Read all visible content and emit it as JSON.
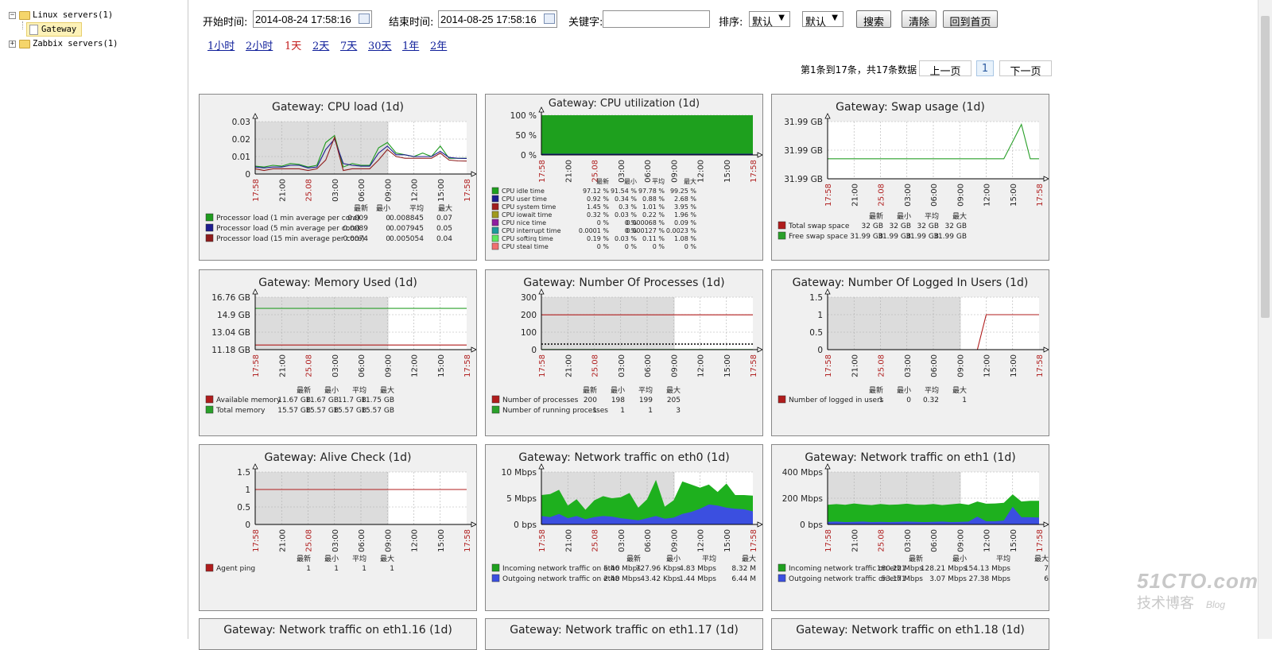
{
  "tree": {
    "linux_servers": "Linux servers(1)",
    "gateway": "Gateway",
    "zabbix_servers": "Zabbix servers(1)"
  },
  "toolbar": {
    "start_label": "开始时间:",
    "start_value": "2014-08-24 17:58:16",
    "end_label": "结束时间:",
    "end_value": "2014-08-25 17:58:16",
    "keyword_label": "关键字:",
    "keyword_value": "",
    "sort_label": "排序:",
    "sort1": "默认",
    "sort2": "默认",
    "search_btn": "搜索",
    "clear_btn": "清除",
    "home_btn": "回到首页"
  },
  "periods": [
    "1小时",
    "2小时",
    "1天",
    "2天",
    "7天",
    "30天",
    "1年",
    "2年"
  ],
  "active_period_index": 2,
  "pagination": {
    "summary": "第1条到17条，共17条数据",
    "prev": "上一页",
    "page": "1",
    "next": "下一页"
  },
  "time_ticks": [
    "17:58",
    "21:00",
    "25.08",
    "03:00",
    "06:00",
    "09:00",
    "12:00",
    "15:00",
    "17:58"
  ],
  "red_ticks": [
    0,
    2,
    8
  ],
  "stat_headers": [
    "最新",
    "最小",
    "平均",
    "最大"
  ],
  "graphs": [
    {
      "title": "Gateway: CPU load (1d)",
      "yticks": [
        "0.03",
        "0.02",
        "0.01",
        "0"
      ],
      "legend": [
        {
          "color": "#1e9b1e",
          "name": "Processor load (1 min average per core)",
          "stats": [
            "0.009",
            "0",
            "0.008845",
            "0.07"
          ]
        },
        {
          "color": "#1d1d8f",
          "name": "Processor load (5 min average per core)",
          "stats": [
            "0.0089",
            "0",
            "0.007945",
            "0.05"
          ]
        },
        {
          "color": "#8f1d1d",
          "name": "Processor load (15 min average per core)",
          "stats": [
            "0.0074",
            "0",
            "0.005054",
            "0.04"
          ]
        }
      ],
      "series": [
        {
          "color": "#1e9b1e",
          "y": [
            0.0045,
            0.004,
            0.005,
            0.0045,
            0.006,
            0.0055,
            0.004,
            0.005,
            0.018,
            0.022,
            0.004,
            0.006,
            0.005,
            0.005,
            0.015,
            0.018,
            0.012,
            0.011,
            0.01,
            0.012,
            0.01,
            0.016,
            0.009,
            0.009,
            0.009
          ]
        },
        {
          "color": "#1d1d8f",
          "y": [
            0.004,
            0.0035,
            0.004,
            0.004,
            0.005,
            0.005,
            0.0035,
            0.004,
            0.014,
            0.02,
            0.006,
            0.005,
            0.0045,
            0.0045,
            0.012,
            0.016,
            0.011,
            0.011,
            0.01,
            0.01,
            0.01,
            0.013,
            0.0095,
            0.009,
            0.0089
          ]
        },
        {
          "color": "#8f1d1d",
          "y": [
            0.003,
            0.002,
            0.003,
            0.003,
            0.003,
            0.003,
            0.002,
            0.003,
            0.008,
            0.021,
            0.002,
            0.003,
            0.003,
            0.003,
            0.008,
            0.014,
            0.01,
            0.009,
            0.009,
            0.009,
            0.009,
            0.012,
            0.008,
            0.0075,
            0.0074
          ]
        }
      ],
      "ymin": 0,
      "ymax": 0.03,
      "shade_frac": 0.63
    },
    {
      "title": "Gateway: CPU utilization (1d)",
      "yticks": [
        "100 %",
        "50 %",
        "0 %"
      ],
      "legend": [
        {
          "color": "#1ea01e",
          "name": "CPU idle time",
          "stats": [
            "97.12 %",
            "91.54 %",
            "97.78 %",
            "99.25 %"
          ]
        },
        {
          "color": "#1d1d8f",
          "name": "CPU user time",
          "stats": [
            "0.92 %",
            "0.34 %",
            "0.88 %",
            "2.68 %"
          ]
        },
        {
          "color": "#a01d1d",
          "name": "CPU system time",
          "stats": [
            "1.45 %",
            "0.3 %",
            "1.01 %",
            "3.95 %"
          ]
        },
        {
          "color": "#a09a1d",
          "name": "CPU iowait time",
          "stats": [
            "0.32 %",
            "0.03 %",
            "0.22 %",
            "1.96 %"
          ]
        },
        {
          "color": "#8f1da0",
          "name": "CPU nice time",
          "stats": [
            "0 %",
            "0 %",
            "0.000068 %",
            "0.09 %"
          ]
        },
        {
          "color": "#1d9a9a",
          "name": "CPU interrupt time",
          "stats": [
            "0.0001 %",
            "0 %",
            "0.000127 %",
            "0.0023 %"
          ]
        },
        {
          "color": "#5ee85e",
          "name": "CPU softirq time",
          "stats": [
            "0.19 %",
            "0.03 %",
            "0.11 %",
            "1.08 %"
          ]
        },
        {
          "color": "#f07070",
          "name": "CPU steal time",
          "stats": [
            "0 %",
            "0 %",
            "0 %",
            "0 %"
          ]
        }
      ],
      "ymin": 0,
      "ymax": 100
    },
    {
      "title": "Gateway: Swap usage (1d)",
      "yticks": [
        "31.99 GB",
        "31.99 GB",
        "31.99 GB"
      ],
      "legend": [
        {
          "color": "#b01c1c",
          "name": "Total swap space",
          "stats": [
            "32 GB",
            "32 GB",
            "32 GB",
            "32 GB"
          ]
        },
        {
          "color": "#2aa02a",
          "name": "Free swap space",
          "stats": [
            "31.99 GB",
            "31.99 GB",
            "31.99 GB",
            "31.99 GB"
          ]
        }
      ],
      "series": [
        {
          "color": "#2aa02a",
          "y": [
            0.35,
            0.35,
            0.35,
            0.35,
            0.35,
            0.35,
            0.35,
            0.35,
            0.35,
            0.35,
            0.35,
            0.35,
            0.35,
            0.35,
            0.35,
            0.35,
            0.35,
            0.35,
            0.35,
            0.35,
            0.35,
            0.65,
            0.95,
            0.35,
            0.35
          ]
        }
      ],
      "ymin": 0,
      "ymax": 1
    },
    {
      "title": "Gateway: Memory Used (1d)",
      "yticks": [
        "16.76 GB",
        "14.9 GB",
        "13.04 GB",
        "11.18 GB"
      ],
      "legend": [
        {
          "color": "#b01c1c",
          "name": "Available memory",
          "stats": [
            "11.67 GB",
            "11.67 GB",
            "11.7 GB",
            "11.75 GB"
          ]
        },
        {
          "color": "#2aa02a",
          "name": "Total memory",
          "stats": [
            "15.57 GB",
            "15.57 GB",
            "15.57 GB",
            "15.57 GB"
          ]
        }
      ],
      "series": [
        {
          "color": "#2aa02a",
          "y": [
            15.57,
            15.57
          ]
        },
        {
          "color": "#b01c1c",
          "y": [
            11.67,
            11.67
          ]
        }
      ],
      "ymin": 11.18,
      "ymax": 16.76,
      "shade_frac": 0.63
    },
    {
      "title": "Gateway: Number Of  Processes (1d)",
      "yticks": [
        "300",
        "200",
        "100",
        "0"
      ],
      "legend": [
        {
          "color": "#b01c1c",
          "name": "Number of processes",
          "stats": [
            "200",
            "198",
            "199",
            "205"
          ]
        },
        {
          "color": "#2aa02a",
          "name": "Number of running processes",
          "stats": [
            "1",
            "1",
            "1",
            "3"
          ]
        }
      ],
      "series": [
        {
          "color": "#b01c1c",
          "y": [
            199,
            199
          ]
        },
        {
          "color": "#2aa02a",
          "y": [
            1,
            1
          ]
        }
      ],
      "ymin": 0,
      "ymax": 300,
      "shade_frac": 0.63
    },
    {
      "title": "Gateway: Number Of Logged In Users (1d)",
      "yticks": [
        "1.5",
        "1",
        "0.5",
        "0"
      ],
      "legend": [
        {
          "color": "#b01c1c",
          "name": "Number of logged in users",
          "stats": [
            "1",
            "0",
            "0.32",
            "1"
          ]
        }
      ],
      "series": [
        {
          "color": "#b01c1c",
          "y": [
            0,
            0,
            0,
            0,
            0,
            0,
            0,
            0,
            0,
            0,
            0,
            0,
            0,
            0,
            0,
            0,
            0,
            0,
            1,
            1,
            1,
            1,
            1,
            1,
            1
          ]
        }
      ],
      "ymin": 0,
      "ymax": 1.5,
      "shade_frac": 0.63
    },
    {
      "title": "Gateway: Alive Check (1d)",
      "yticks": [
        "1.5",
        "1",
        "0.5",
        "0"
      ],
      "legend": [
        {
          "color": "#b01c1c",
          "name": "Agent ping",
          "stats": [
            "1",
            "1",
            "1",
            "1"
          ]
        }
      ],
      "series": [
        {
          "color": "#b01c1c",
          "y": [
            1,
            1
          ]
        }
      ],
      "ymin": 0,
      "ymax": 1.5,
      "shade_frac": 0.63
    },
    {
      "title": "Gateway: Network traffic on eth0 (1d)",
      "yticks": [
        "10 Mbps",
        "5 Mbps",
        "0 bps"
      ],
      "legend": [
        {
          "color": "#1ea01e",
          "name": "Incoming network traffic on eth0",
          "stats": [
            "5.46 Mbps",
            "727.96 Kbps",
            "4.83 Mbps",
            "8.32 M"
          ]
        },
        {
          "color": "#3b4fe0",
          "name": "Outgoing network traffic on eth0",
          "stats": [
            "2.48 Mbps",
            "43.42 Kbps",
            "1.44 Mbps",
            "6.44 M"
          ]
        }
      ],
      "area": [
        {
          "color": "#1eb01e",
          "y": [
            5.6,
            5.8,
            6.6,
            3.6,
            4.8,
            2.8,
            4.6,
            5.4,
            5.0,
            5.2,
            6.0,
            3.2,
            4.8,
            8.5,
            3.4,
            4.6,
            8.2,
            7.6,
            7.0,
            7.6,
            6.2,
            7.8,
            5.6,
            5.6,
            5.5
          ]
        },
        {
          "color": "#3b4fe0",
          "y": [
            1.6,
            1.4,
            2.0,
            1.2,
            1.6,
            1.0,
            1.4,
            1.6,
            1.5,
            1.2,
            1.0,
            0.8,
            1.2,
            1.6,
            1.1,
            1.3,
            2.0,
            2.4,
            3.0,
            3.8,
            3.6,
            3.2,
            3.0,
            2.9,
            2.5
          ]
        }
      ],
      "ymin": 0,
      "ymax": 10,
      "shade_frac": 0.63
    },
    {
      "title": "Gateway: Network traffic on eth1 (1d)",
      "yticks": [
        "400 Mbps",
        "200 Mbps",
        "0 bps"
      ],
      "legend": [
        {
          "color": "#1ea01e",
          "name": "Incoming network traffic on eth1",
          "stats": [
            "180.22 Mbps",
            "128.21 Mbps",
            "154.13 Mbps",
            "7"
          ]
        },
        {
          "color": "#3b4fe0",
          "name": "Outgoing network traffic on eth1",
          "stats": [
            "53.17 Mbps",
            "3.07 Mbps",
            "27.38 Mbps",
            "6"
          ]
        }
      ],
      "area": [
        {
          "color": "#1eb01e",
          "y": [
            150,
            155,
            150,
            160,
            152,
            148,
            156,
            150,
            152,
            158,
            150,
            150,
            156,
            148,
            154,
            160,
            150,
            175,
            158,
            160,
            165,
            230,
            175,
            180,
            180
          ]
        },
        {
          "color": "#3b4fe0",
          "y": [
            20,
            22,
            18,
            20,
            22,
            18,
            20,
            18,
            20,
            22,
            20,
            18,
            20,
            22,
            18,
            20,
            22,
            60,
            24,
            24,
            30,
            135,
            55,
            55,
            53
          ]
        }
      ],
      "ymin": 0,
      "ymax": 400,
      "shade_frac": 0.63
    }
  ],
  "bottom_titles": [
    "Gateway: Network traffic on eth1.16 (1d)",
    "Gateway: Network traffic on eth1.17 (1d)",
    "Gateway: Network traffic on eth1.18 (1d)"
  ],
  "watermark": {
    "brand": "51CTO.com",
    "sub": "技术博客",
    "blog": "Blog"
  }
}
